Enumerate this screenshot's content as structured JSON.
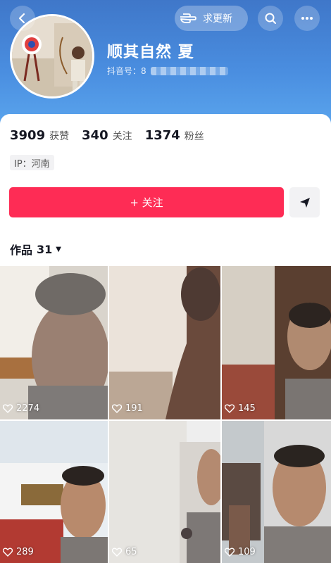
{
  "header": {
    "update_label": "求更新",
    "icons": [
      "back-icon",
      "pointing-hand-icon",
      "search-icon",
      "more-icon"
    ]
  },
  "profile": {
    "nickname": "顺其自然 夏",
    "douyin_id_label": "抖音号：8"
  },
  "stats": [
    {
      "value": "3909",
      "label": "获赞"
    },
    {
      "value": "340",
      "label": "关注"
    },
    {
      "value": "1374",
      "label": "粉丝"
    }
  ],
  "ip_tag": "IP：河南",
  "follow_label": "+ 关注",
  "works": {
    "label": "作品",
    "count": "31"
  },
  "videos": [
    {
      "likes": "2274"
    },
    {
      "likes": "191"
    },
    {
      "likes": "145"
    },
    {
      "likes": "289"
    },
    {
      "likes": "65"
    },
    {
      "likes": "109"
    }
  ],
  "colors": {
    "follow_button": "#fe2c55",
    "header_blue": "#4a8ee0"
  }
}
